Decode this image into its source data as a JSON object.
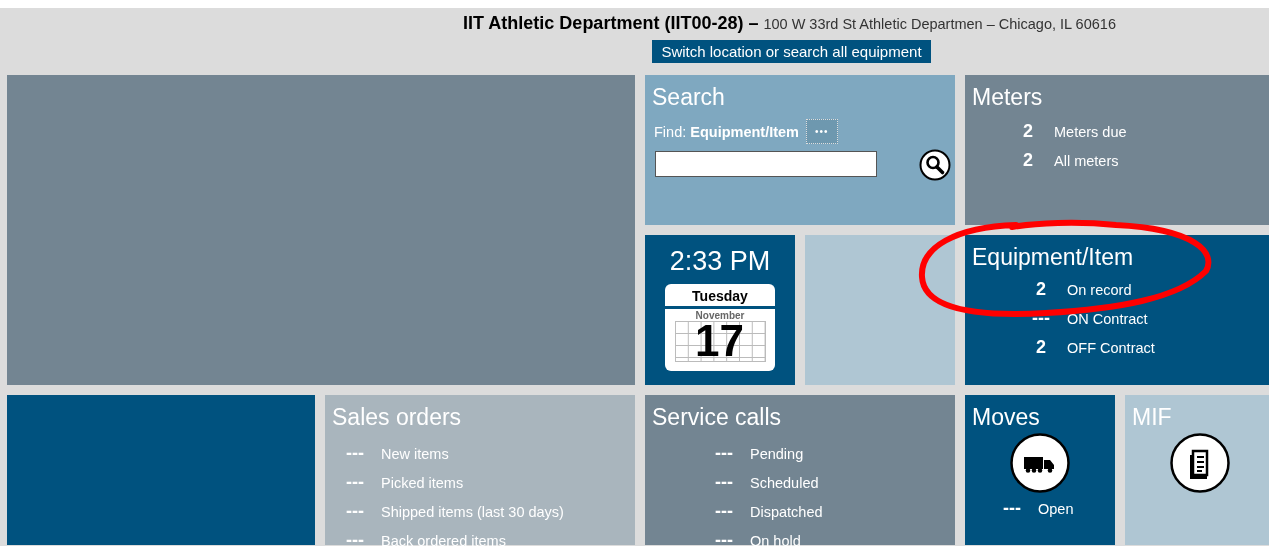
{
  "header": {
    "location": "IIT Athletic Department (IIT00-28)",
    "separator": "–",
    "address": "100 W 33rd St Athletic Departmen – Chicago, IL 60616",
    "switch_button": "Switch location or search all equipment"
  },
  "tiles": [
    {
      "kind": "blank",
      "color": "#738592"
    },
    {
      "kind": "search",
      "color": "#7fa8c0",
      "title": "Search",
      "find_label": "Find:",
      "find_value": "Equipment/Item",
      "more_button": "•••"
    },
    {
      "kind": "stats",
      "color": "#738592",
      "title": "Meters",
      "rows": [
        {
          "value": "2",
          "label": "Meters due"
        },
        {
          "value": "2",
          "label": "All meters"
        }
      ]
    },
    {
      "kind": "clock",
      "color": "#00527f",
      "time": "2:33 PM",
      "weekday": "Tuesday",
      "month": "November",
      "day": "17"
    },
    {
      "kind": "blank",
      "color": "#afc6d3"
    },
    {
      "kind": "stats",
      "color": "#00527f",
      "title": "Equipment/Item",
      "rows": [
        {
          "value": "2",
          "label": "On record"
        },
        {
          "value": "---",
          "label": "ON Contract"
        },
        {
          "value": "2",
          "label": "OFF Contract"
        }
      ]
    },
    {
      "kind": "blank",
      "color": "#00527f"
    },
    {
      "kind": "stats",
      "color": "#a9b5bd",
      "title": "Sales orders",
      "rows": [
        {
          "value": "---",
          "label": "New items"
        },
        {
          "value": "---",
          "label": "Picked items"
        },
        {
          "value": "---",
          "label": "Shipped items (last 30 days)"
        },
        {
          "value": "---",
          "label": "Back ordered items"
        }
      ]
    },
    {
      "kind": "stats",
      "color": "#738592",
      "title": "Service calls",
      "rows": [
        {
          "value": "---",
          "label": "Pending"
        },
        {
          "value": "---",
          "label": "Scheduled"
        },
        {
          "value": "---",
          "label": "Dispatched"
        },
        {
          "value": "---",
          "label": "On hold"
        }
      ]
    },
    {
      "kind": "icon",
      "color": "#00527f",
      "title": "Moves",
      "rows": [
        {
          "value": "---",
          "label": "Open"
        }
      ]
    },
    {
      "kind": "icon",
      "color": "#afc6d3",
      "title": "MIF"
    }
  ],
  "annotations": [
    {
      "kind": "ellipse"
    }
  ]
}
